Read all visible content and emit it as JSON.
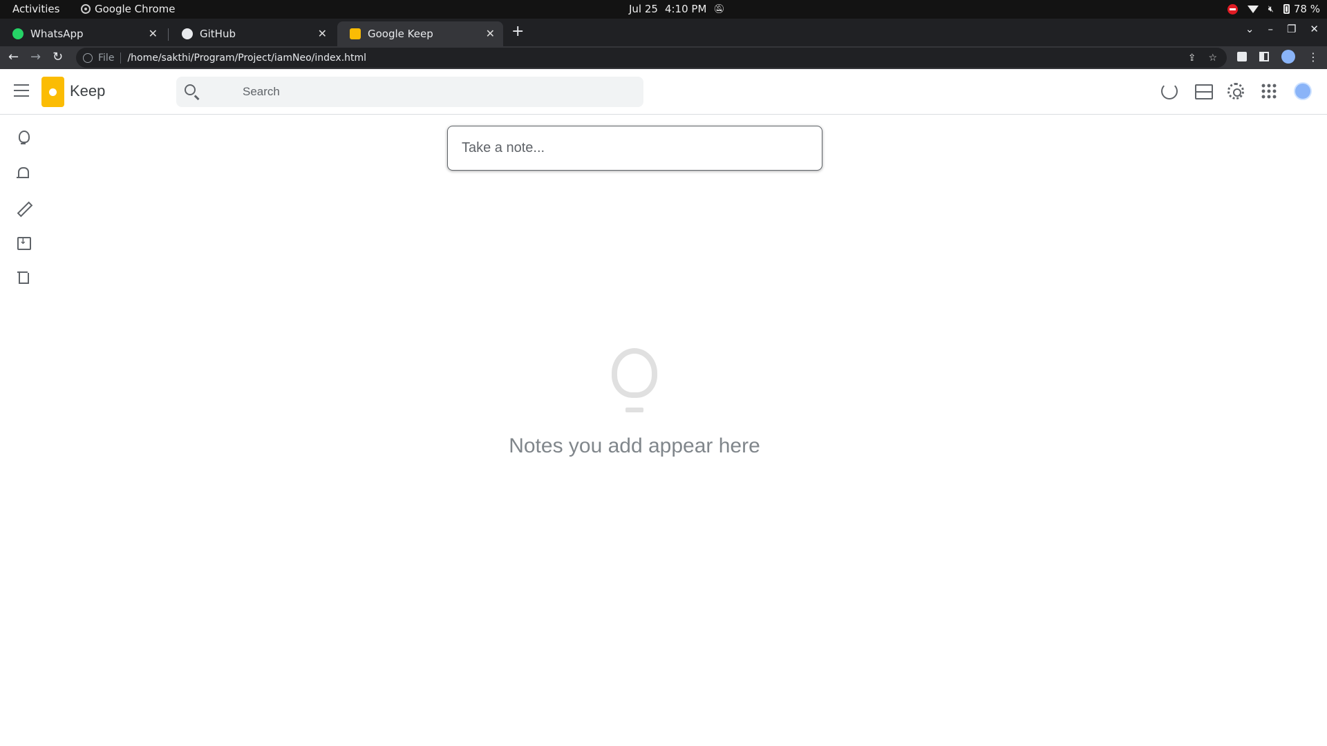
{
  "os_bar": {
    "activities": "Activities",
    "app_name": "Google Chrome",
    "date": "Jul 25",
    "time": "4:10 PM",
    "battery": "78 %"
  },
  "tabs": [
    {
      "title": "WhatsApp",
      "icon": "whatsapp-icon"
    },
    {
      "title": "GitHub",
      "icon": "github-icon"
    },
    {
      "title": "Google Keep",
      "icon": "keep-icon",
      "active": true
    }
  ],
  "address_bar": {
    "scheme_label": "File",
    "url": "/home/sakthi/Program/Project/iamNeo/index.html"
  },
  "keep": {
    "app_title": "Keep",
    "search_placeholder": "Search",
    "note_placeholder": "Take a note...",
    "empty_message": "Notes you add appear here",
    "sidebar": [
      "bulb-icon",
      "bell-icon",
      "pencil-icon",
      "archive-icon",
      "trash-icon"
    ],
    "brand_color": "#fbbc04"
  }
}
